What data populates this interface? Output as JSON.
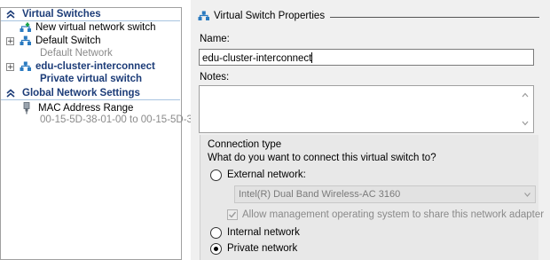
{
  "tree": {
    "virtual_switches": {
      "title": "Virtual Switches",
      "new_switch": "New virtual network switch",
      "items": [
        {
          "name": "Default Switch",
          "subtitle": "Default Network"
        },
        {
          "name": "edu-cluster-interconnect",
          "subtitle": "Private virtual switch"
        }
      ]
    },
    "global_settings": {
      "title": "Global Network Settings",
      "mac": {
        "name": "MAC Address Range",
        "value": "00-15-5D-38-01-00 to 00-15-5D-3..."
      }
    }
  },
  "properties": {
    "group_title": "Virtual Switch Properties",
    "name_label": "Name:",
    "name_value": "edu-cluster-interconnect",
    "notes_label": "Notes:",
    "notes_value": "",
    "connection": {
      "title": "Connection type",
      "question": "What do you want to connect this virtual switch to?",
      "external_label": "External network:",
      "adapter_value": "Intel(R) Dual Band Wireless-AC 3160",
      "allow_management": "Allow management operating system to share this network adapter",
      "internal_label": "Internal network",
      "private_label": "Private network",
      "selected": "private"
    }
  },
  "colors": {
    "header_text": "#1c3c78",
    "header_rule": "#a8c4e0",
    "pane_bg": "#f0f0f0"
  }
}
